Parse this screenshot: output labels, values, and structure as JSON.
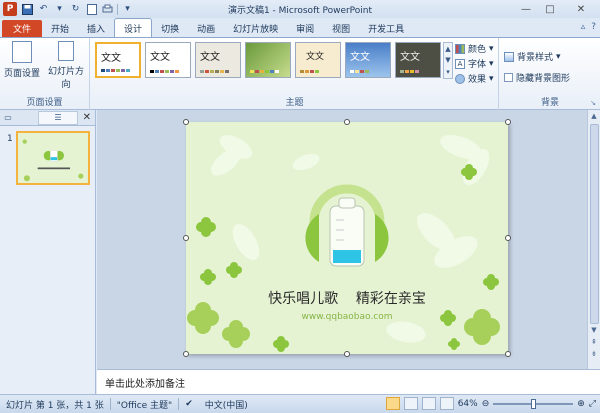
{
  "titlebar": {
    "app_letter": "P",
    "title": "演示文稿1 - Microsoft PowerPoint"
  },
  "tabs": {
    "file": "文件",
    "items": [
      "开始",
      "插入",
      "设计",
      "切换",
      "动画",
      "幻灯片放映",
      "审阅",
      "视图",
      "开发工具"
    ],
    "active": "设计"
  },
  "ribbon": {
    "page_setup_group": {
      "label": "页面设置",
      "page_setup_btn": "页面设置",
      "orientation_btn": "幻灯片方向"
    },
    "themes_group": {
      "label": "主题",
      "theme_text": "文文",
      "theme_count": 7
    },
    "colors_btn": "颜色",
    "fonts_btn": "字体",
    "effects_btn": "效果",
    "background_group": {
      "label": "背景",
      "bg_styles_btn": "背景样式",
      "hide_bg_checkbox": "隐藏背景图形"
    }
  },
  "slide": {
    "title": "快乐唱儿歌    精彩在亲宝",
    "url": "www.qqbaobao.com",
    "number": "1"
  },
  "notes_placeholder": "单击此处添加备注",
  "status": {
    "slide_info": "幻灯片 第 1 张，共 1 张",
    "theme": "\"Office 主题\"",
    "language": "中文(中国)",
    "zoom": "64%"
  },
  "colors": {
    "file_tab": "#d24726",
    "slide_bg": "#e5f3d3",
    "leaf": "#8cc63f",
    "selected_border": "#f4b33f"
  }
}
